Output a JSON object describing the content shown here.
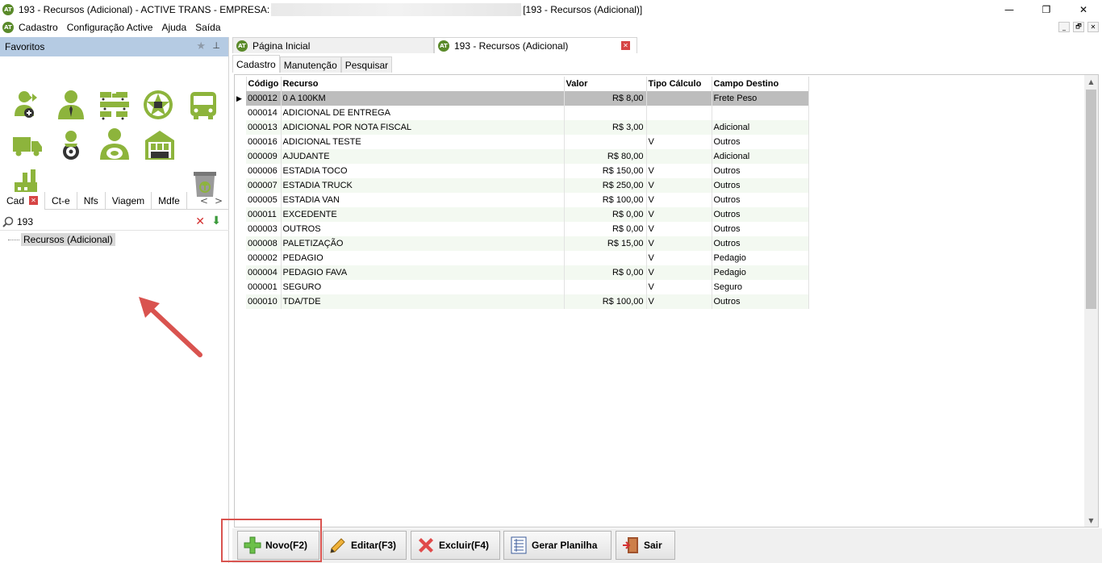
{
  "window": {
    "title_prefix": "193 - Recursos (Adicional) - ACTIVE TRANS - EMPRESA:",
    "title_suffix": "[193 - Recursos (Adicional)]",
    "logo_text": "AT",
    "minimize": "—",
    "maximize": "❐",
    "close": "✕"
  },
  "menu": {
    "items": [
      "Cadastro",
      "Configuração Active",
      "Ajuda",
      "Saída"
    ],
    "mdi": [
      "_",
      "🗗",
      "✕"
    ]
  },
  "sidebar": {
    "header": "Favoritos",
    "star": "★",
    "pin": "⊥",
    "tabs": [
      {
        "label": "Cad",
        "close": "✕"
      },
      {
        "label": "Ct-e"
      },
      {
        "label": "Nfs"
      },
      {
        "label": "Viagem"
      },
      {
        "label": "Mdfe"
      }
    ],
    "tab_prev": "<",
    "tab_next": ">",
    "search_value": "193",
    "search_clear": "✕",
    "search_go": "⬇",
    "tree_item": "Recursos (Adicional)"
  },
  "document_tabs": [
    {
      "label": "Página Inicial"
    },
    {
      "label": "193 - Recursos (Adicional)",
      "close": "✕"
    }
  ],
  "sub_tabs": [
    "Cadastro",
    "Manutenção",
    "Pesquisar"
  ],
  "grid": {
    "columns": [
      "Código",
      "Recurso",
      "Valor",
      "Tipo Cálculo",
      "Campo Destino"
    ],
    "row_indicator": "▶",
    "rows": [
      {
        "codigo": "000012",
        "recurso": "0 A 100KM",
        "valor": "R$ 8,00",
        "tipo": "",
        "campo": "Frete Peso"
      },
      {
        "codigo": "000014",
        "recurso": "ADICIONAL DE ENTREGA",
        "valor": "",
        "tipo": "",
        "campo": ""
      },
      {
        "codigo": "000013",
        "recurso": "ADICIONAL POR NOTA FISCAL",
        "valor": "R$ 3,00",
        "tipo": "",
        "campo": "Adicional"
      },
      {
        "codigo": "000016",
        "recurso": "ADICIONAL TESTE",
        "valor": "",
        "tipo": "V",
        "campo": "Outros"
      },
      {
        "codigo": "000009",
        "recurso": "AJUDANTE",
        "valor": "R$ 80,00",
        "tipo": "",
        "campo": "Adicional"
      },
      {
        "codigo": "000006",
        "recurso": "ESTADIA TOCO",
        "valor": "R$ 150,00",
        "tipo": "V",
        "campo": "Outros"
      },
      {
        "codigo": "000007",
        "recurso": "ESTADIA TRUCK",
        "valor": "R$ 250,00",
        "tipo": "V",
        "campo": "Outros"
      },
      {
        "codigo": "000005",
        "recurso": "ESTADIA VAN",
        "valor": "R$ 100,00",
        "tipo": "V",
        "campo": "Outros"
      },
      {
        "codigo": "000011",
        "recurso": "EXCEDENTE",
        "valor": "R$ 0,00",
        "tipo": "V",
        "campo": "Outros"
      },
      {
        "codigo": "000003",
        "recurso": "OUTROS",
        "valor": "R$ 0,00",
        "tipo": "V",
        "campo": "Outros"
      },
      {
        "codigo": "000008",
        "recurso": "PALETIZAÇÃO",
        "valor": "R$ 15,00",
        "tipo": "V",
        "campo": "Outros"
      },
      {
        "codigo": "000002",
        "recurso": "PEDAGIO",
        "valor": "",
        "tipo": "V",
        "campo": "Pedagio"
      },
      {
        "codigo": "000004",
        "recurso": "PEDAGIO FAVA",
        "valor": "R$ 0,00",
        "tipo": "V",
        "campo": "Pedagio"
      },
      {
        "codigo": "000001",
        "recurso": "SEGURO",
        "valor": "",
        "tipo": "V",
        "campo": "Seguro"
      },
      {
        "codigo": "000010",
        "recurso": "TDA/TDE",
        "valor": "R$ 100,00",
        "tipo": "V",
        "campo": "Outros"
      }
    ],
    "scroll_up": "▲",
    "scroll_down": "▼"
  },
  "toolbar": {
    "novo": "Novo(F2)",
    "editar": "Editar(F3)",
    "excluir": "Excluir(F4)",
    "planilha": "Gerar Planilha",
    "sair": "Sair"
  },
  "colors": {
    "brand_green": "#8db43c",
    "selected_row": "#bdbdbd",
    "alt_row": "#f3f9f1",
    "favorites_header": "#b5cbe3",
    "annotation_red": "#d9534f"
  }
}
